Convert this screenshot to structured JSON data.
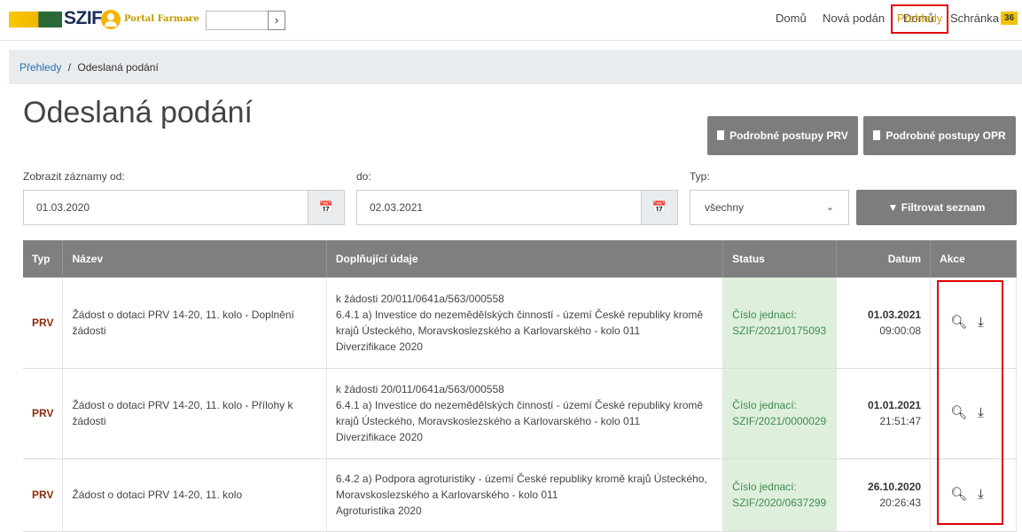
{
  "header": {
    "logo_text": "SZIF",
    "portal_label": "Portal Farmare",
    "nav": {
      "domu": "Domů",
      "nova": "Nová podán",
      "prehledy": "Přehledy",
      "schranka": "Schránka",
      "badge": "36"
    }
  },
  "breadcrumb": {
    "link": "Přehledy",
    "separator": "/",
    "current": "Odeslaná podání"
  },
  "page_title": "Odeslaná podání",
  "buttons": {
    "prv": "Podrobné postupy PRV",
    "opr": "Podrobné postupy OPR",
    "filter": "Filtrovat seznam"
  },
  "filter": {
    "from_label": "Zobrazit záznamy od:",
    "from_value": "01.03.2020",
    "to_label": "do:",
    "to_value": "02.03.2021",
    "type_label": "Typ:",
    "type_value": "všechny"
  },
  "table": {
    "headers": {
      "typ": "Typ",
      "nazev": "Název",
      "doplnujici": "Doplňující údaje",
      "status": "Status",
      "datum": "Datum",
      "akce": "Akce"
    },
    "rows": [
      {
        "typ": "PRV",
        "nazev_1": "Žádost o dotaci PRV 14-20, 11. kolo - Doplnění",
        "nazev_2": "žádosti",
        "info_1": "k žádosti 20/011/0641a/563/000558",
        "info_2": "6.4.1 a) Investice do nezemědělských činností - území České republiky kromě",
        "info_3": "krajů Ústeckého, Moravskoslezského a Karlovarského - kolo 011",
        "info_4": "Diverzifikace 2020",
        "status_1": "Číslo jednací:",
        "status_2": "SZIF/2021/0175093",
        "date": "01.03.2021",
        "time": "09:00:08"
      },
      {
        "typ": "PRV",
        "nazev_1": "Žádost o dotaci PRV 14-20, 11. kolo - Přílohy k",
        "nazev_2": "žádosti",
        "info_1": "k žádosti 20/011/0641a/563/000558",
        "info_2": "6.4.1 a) Investice do nezemědělských činností - území České republiky kromě",
        "info_3": "krajů Ústeckého, Moravskoslezského a Karlovarského - kolo 011",
        "info_4": "Diverzifikace 2020",
        "status_1": "Číslo jednací:",
        "status_2": "SZIF/2021/0000029",
        "date": "01.01.2021",
        "time": "21:51:47"
      },
      {
        "typ": "PRV",
        "nazev_1": "Žádost o dotaci PRV 14-20, 11. kolo",
        "info_1": "6.4.2 a) Podpora agroturistiky - území České republiky kromě krajů Ústeckého,",
        "info_2": "Moravskoslezského a Karlovarského - kolo 011",
        "info_3": "Agroturistika 2020",
        "status_1": "Číslo jednací:",
        "status_2": "SZIF/2020/0637299",
        "date": "26.10.2020",
        "time": "20:26:43"
      }
    ]
  },
  "icons": {
    "view": "magnifier-icon",
    "download": "download-icon",
    "calendar": "calendar-icon",
    "filter": "funnel-icon",
    "document": "document-icon"
  },
  "colors": {
    "accent": "#d19a00",
    "status_bg": "#def0dc",
    "status_text": "#3f8a4f",
    "typ_text": "#8b2a08",
    "header_bg": "#7f7f7f",
    "highlight_box": "#e00000"
  }
}
